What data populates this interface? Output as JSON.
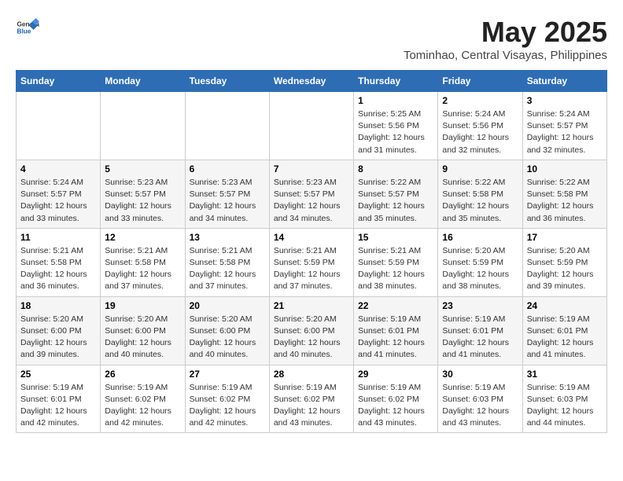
{
  "header": {
    "logo_line1": "General",
    "logo_line2": "Blue",
    "month_title": "May 2025",
    "subtitle": "Tominhao, Central Visayas, Philippines"
  },
  "weekdays": [
    "Sunday",
    "Monday",
    "Tuesday",
    "Wednesday",
    "Thursday",
    "Friday",
    "Saturday"
  ],
  "weeks": [
    [
      {
        "day": "",
        "info": ""
      },
      {
        "day": "",
        "info": ""
      },
      {
        "day": "",
        "info": ""
      },
      {
        "day": "",
        "info": ""
      },
      {
        "day": "1",
        "info": "Sunrise: 5:25 AM\nSunset: 5:56 PM\nDaylight: 12 hours\nand 31 minutes."
      },
      {
        "day": "2",
        "info": "Sunrise: 5:24 AM\nSunset: 5:56 PM\nDaylight: 12 hours\nand 32 minutes."
      },
      {
        "day": "3",
        "info": "Sunrise: 5:24 AM\nSunset: 5:57 PM\nDaylight: 12 hours\nand 32 minutes."
      }
    ],
    [
      {
        "day": "4",
        "info": "Sunrise: 5:24 AM\nSunset: 5:57 PM\nDaylight: 12 hours\nand 33 minutes."
      },
      {
        "day": "5",
        "info": "Sunrise: 5:23 AM\nSunset: 5:57 PM\nDaylight: 12 hours\nand 33 minutes."
      },
      {
        "day": "6",
        "info": "Sunrise: 5:23 AM\nSunset: 5:57 PM\nDaylight: 12 hours\nand 34 minutes."
      },
      {
        "day": "7",
        "info": "Sunrise: 5:23 AM\nSunset: 5:57 PM\nDaylight: 12 hours\nand 34 minutes."
      },
      {
        "day": "8",
        "info": "Sunrise: 5:22 AM\nSunset: 5:57 PM\nDaylight: 12 hours\nand 35 minutes."
      },
      {
        "day": "9",
        "info": "Sunrise: 5:22 AM\nSunset: 5:58 PM\nDaylight: 12 hours\nand 35 minutes."
      },
      {
        "day": "10",
        "info": "Sunrise: 5:22 AM\nSunset: 5:58 PM\nDaylight: 12 hours\nand 36 minutes."
      }
    ],
    [
      {
        "day": "11",
        "info": "Sunrise: 5:21 AM\nSunset: 5:58 PM\nDaylight: 12 hours\nand 36 minutes."
      },
      {
        "day": "12",
        "info": "Sunrise: 5:21 AM\nSunset: 5:58 PM\nDaylight: 12 hours\nand 37 minutes."
      },
      {
        "day": "13",
        "info": "Sunrise: 5:21 AM\nSunset: 5:58 PM\nDaylight: 12 hours\nand 37 minutes."
      },
      {
        "day": "14",
        "info": "Sunrise: 5:21 AM\nSunset: 5:59 PM\nDaylight: 12 hours\nand 37 minutes."
      },
      {
        "day": "15",
        "info": "Sunrise: 5:21 AM\nSunset: 5:59 PM\nDaylight: 12 hours\nand 38 minutes."
      },
      {
        "day": "16",
        "info": "Sunrise: 5:20 AM\nSunset: 5:59 PM\nDaylight: 12 hours\nand 38 minutes."
      },
      {
        "day": "17",
        "info": "Sunrise: 5:20 AM\nSunset: 5:59 PM\nDaylight: 12 hours\nand 39 minutes."
      }
    ],
    [
      {
        "day": "18",
        "info": "Sunrise: 5:20 AM\nSunset: 6:00 PM\nDaylight: 12 hours\nand 39 minutes."
      },
      {
        "day": "19",
        "info": "Sunrise: 5:20 AM\nSunset: 6:00 PM\nDaylight: 12 hours\nand 40 minutes."
      },
      {
        "day": "20",
        "info": "Sunrise: 5:20 AM\nSunset: 6:00 PM\nDaylight: 12 hours\nand 40 minutes."
      },
      {
        "day": "21",
        "info": "Sunrise: 5:20 AM\nSunset: 6:00 PM\nDaylight: 12 hours\nand 40 minutes."
      },
      {
        "day": "22",
        "info": "Sunrise: 5:19 AM\nSunset: 6:01 PM\nDaylight: 12 hours\nand 41 minutes."
      },
      {
        "day": "23",
        "info": "Sunrise: 5:19 AM\nSunset: 6:01 PM\nDaylight: 12 hours\nand 41 minutes."
      },
      {
        "day": "24",
        "info": "Sunrise: 5:19 AM\nSunset: 6:01 PM\nDaylight: 12 hours\nand 41 minutes."
      }
    ],
    [
      {
        "day": "25",
        "info": "Sunrise: 5:19 AM\nSunset: 6:01 PM\nDaylight: 12 hours\nand 42 minutes."
      },
      {
        "day": "26",
        "info": "Sunrise: 5:19 AM\nSunset: 6:02 PM\nDaylight: 12 hours\nand 42 minutes."
      },
      {
        "day": "27",
        "info": "Sunrise: 5:19 AM\nSunset: 6:02 PM\nDaylight: 12 hours\nand 42 minutes."
      },
      {
        "day": "28",
        "info": "Sunrise: 5:19 AM\nSunset: 6:02 PM\nDaylight: 12 hours\nand 43 minutes."
      },
      {
        "day": "29",
        "info": "Sunrise: 5:19 AM\nSunset: 6:02 PM\nDaylight: 12 hours\nand 43 minutes."
      },
      {
        "day": "30",
        "info": "Sunrise: 5:19 AM\nSunset: 6:03 PM\nDaylight: 12 hours\nand 43 minutes."
      },
      {
        "day": "31",
        "info": "Sunrise: 5:19 AM\nSunset: 6:03 PM\nDaylight: 12 hours\nand 44 minutes."
      }
    ]
  ]
}
